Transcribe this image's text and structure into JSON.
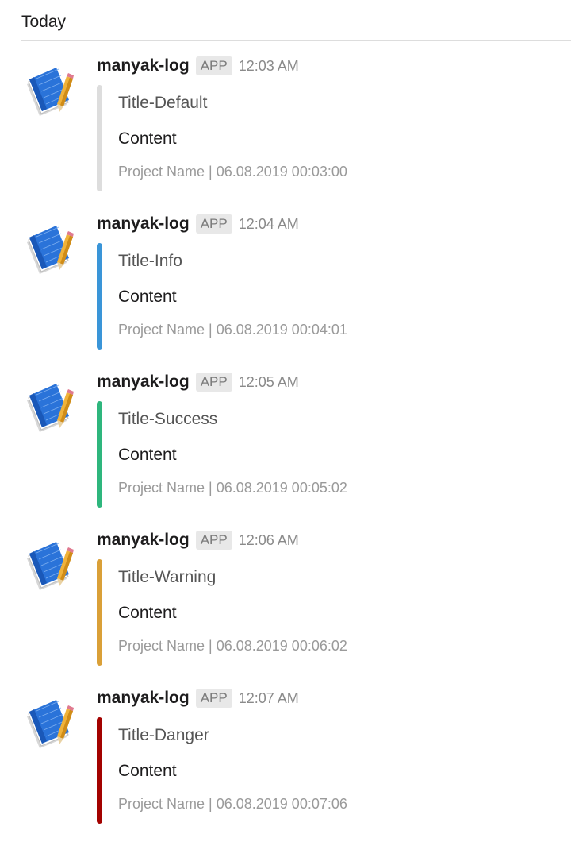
{
  "day_header": "Today",
  "messages": [
    {
      "sender": "manyak-log",
      "badge": "APP",
      "time": "12:03 AM",
      "avatar_icon": "notebook-pencil-icon",
      "attachment": {
        "title": "Title-Default",
        "content": "Content",
        "footer": "Project Name | 06.08.2019 00:03:00",
        "color": "#dddddd"
      }
    },
    {
      "sender": "manyak-log",
      "badge": "APP",
      "time": "12:04 AM",
      "avatar_icon": "notebook-pencil-icon",
      "attachment": {
        "title": "Title-Info",
        "content": "Content",
        "footer": "Project Name | 06.08.2019 00:04:01",
        "color": "#3a95d8"
      }
    },
    {
      "sender": "manyak-log",
      "badge": "APP",
      "time": "12:05 AM",
      "avatar_icon": "notebook-pencil-icon",
      "attachment": {
        "title": "Title-Success",
        "content": "Content",
        "footer": "Project Name | 06.08.2019 00:05:02",
        "color": "#2eb67d"
      }
    },
    {
      "sender": "manyak-log",
      "badge": "APP",
      "time": "12:06 AM",
      "avatar_icon": "notebook-pencil-icon",
      "attachment": {
        "title": "Title-Warning",
        "content": "Content",
        "footer": "Project Name | 06.08.2019 00:06:02",
        "color": "#daa038"
      }
    },
    {
      "sender": "manyak-log",
      "badge": "APP",
      "time": "12:07 AM",
      "avatar_icon": "notebook-pencil-icon",
      "attachment": {
        "title": "Title-Danger",
        "content": "Content",
        "footer": "Project Name | 06.08.2019 00:07:06",
        "color": "#a30200"
      }
    }
  ]
}
